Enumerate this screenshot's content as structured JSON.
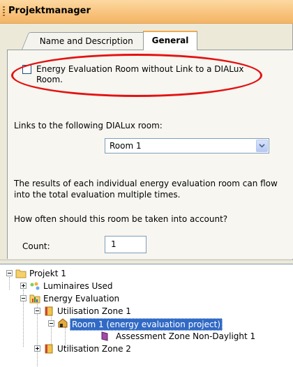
{
  "window": {
    "title": "Projektmanager"
  },
  "tabs": [
    {
      "label": "Name and Description"
    },
    {
      "label": "General"
    }
  ],
  "general": {
    "checkbox_label": "Energy Evaluation Room without Link to a DIALux Room.",
    "checkbox_checked": false,
    "links_label": "Links to the following DIALux room:",
    "room_select_value": "Room 1",
    "results_text": "The results of each individual energy evaluation room can flow into the total evaluation multiple times.",
    "how_often_text": "How often should this room be taken into account?",
    "count_label": "Count:",
    "count_value": "1"
  },
  "tree": {
    "nodes": [
      {
        "label": "Projekt 1",
        "icon": "folder-icon",
        "expanded": true
      },
      {
        "label": "Luminaires Used",
        "icon": "luminaires-icon",
        "expanded": false
      },
      {
        "label": "Energy Evaluation",
        "icon": "energy-evaluation-icon",
        "expanded": true
      },
      {
        "label": "Utilisation Zone 1",
        "icon": "utilisation-zone-icon",
        "expanded": true
      },
      {
        "label": "Room 1 (energy evaluation project)",
        "icon": "room-icon",
        "expanded": true,
        "selected": true
      },
      {
        "label": "Assessment Zone Non-Daylight 1",
        "icon": "assessment-zone-icon"
      },
      {
        "label": "Utilisation Zone 2",
        "icon": "utilisation-zone-icon",
        "expanded": false
      }
    ]
  },
  "colors": {
    "title_bar": "#f8c27a",
    "highlight_ellipse": "#e41212",
    "selection": "#316ac5"
  }
}
